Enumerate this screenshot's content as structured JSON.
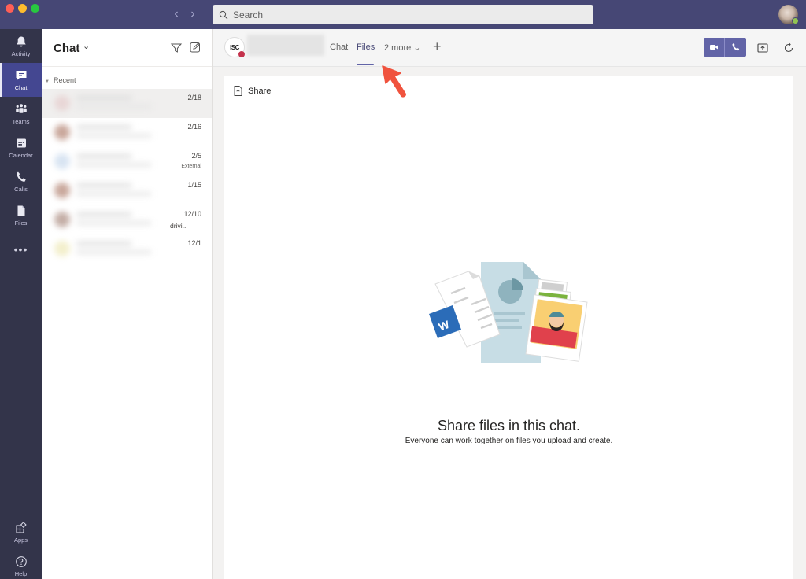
{
  "window": {
    "search_placeholder": "Search",
    "nav_back_glyph": "‹",
    "nav_forward_glyph": "›"
  },
  "rail": {
    "items": [
      {
        "id": "activity",
        "label": "Activity",
        "icon": "bell-icon"
      },
      {
        "id": "chat",
        "label": "Chat",
        "icon": "chat-icon",
        "active": true
      },
      {
        "id": "teams",
        "label": "Teams",
        "icon": "teams-icon"
      },
      {
        "id": "calendar",
        "label": "Calendar",
        "icon": "calendar-icon"
      },
      {
        "id": "calls",
        "label": "Calls",
        "icon": "phone-icon"
      },
      {
        "id": "files",
        "label": "Files",
        "icon": "file-icon"
      }
    ],
    "more_glyph": "•••",
    "bottom": [
      {
        "id": "apps",
        "label": "Apps",
        "icon": "apps-icon"
      },
      {
        "id": "help",
        "label": "Help",
        "icon": "help-icon"
      }
    ]
  },
  "chatlist": {
    "title": "Chat",
    "title_chevron": "⌄",
    "section": "Recent",
    "items": [
      {
        "date": "2/18",
        "sub": "",
        "selected": true,
        "avatar_color": "#e8d6d6"
      },
      {
        "date": "2/16",
        "sub": "",
        "avatar_color": "#c9a79b"
      },
      {
        "date": "2/5",
        "sub": "External",
        "avatar_color": "#d8e4f2"
      },
      {
        "date": "1/15",
        "sub": "",
        "avatar_color": "#c9a89c"
      },
      {
        "date": "12/10",
        "sub": "drivi...",
        "avatar_color": "#c4aea6"
      },
      {
        "date": "12/1",
        "sub": "",
        "avatar_color": "#f3efcc"
      }
    ]
  },
  "header": {
    "channel_avatar_text": "ISC",
    "tabs": [
      {
        "label": "Chat",
        "active": false
      },
      {
        "label": "Files",
        "active": true
      },
      {
        "label": "2 more ⌄",
        "active": false
      }
    ],
    "add_tab_glyph": "+"
  },
  "content": {
    "share_label": "Share",
    "empty_title": "Share files in this chat.",
    "empty_subtitle": "Everyone can work together on files you upload and create."
  },
  "colors": {
    "titlebar": "#464775",
    "rail": "#33344a",
    "accent": "#6264a7",
    "annotation_arrow": "#f0533e"
  }
}
